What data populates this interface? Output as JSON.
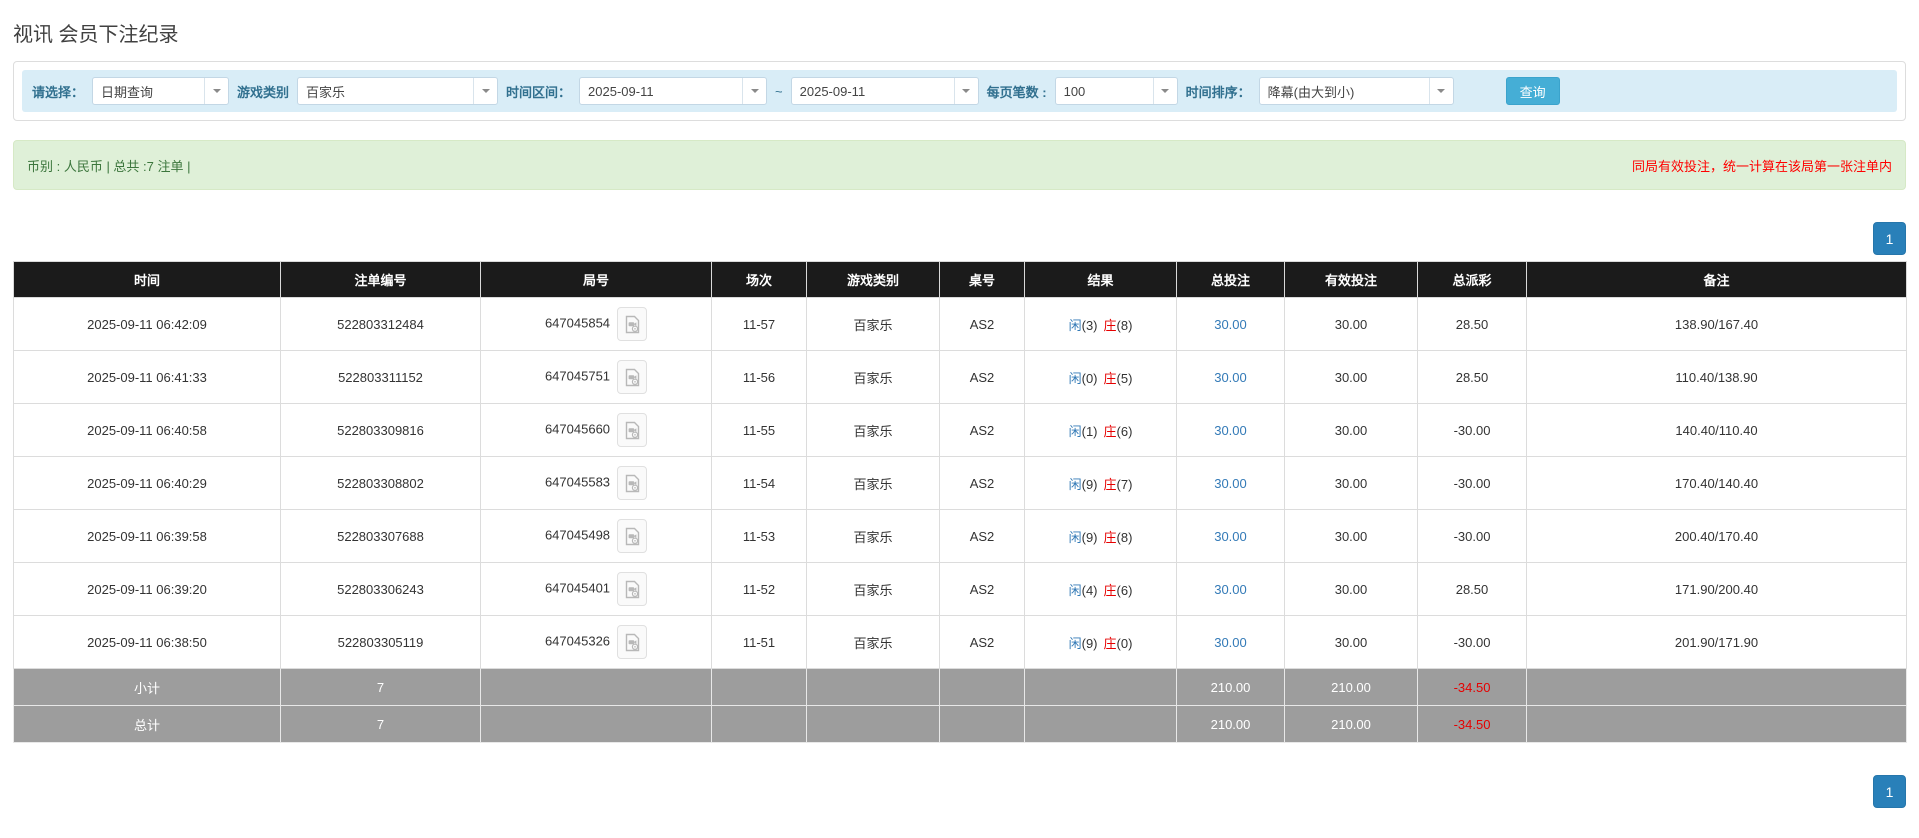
{
  "page": {
    "title": "视讯 会员下注纪录"
  },
  "filters": {
    "select_label": "请选择：",
    "select_value": "日期查询",
    "game_label": "游戏类别",
    "game_value": "百家乐",
    "range_label": "时间区间：",
    "date_from": "2025-09-11",
    "range_sep": "~",
    "date_to": "2025-09-11",
    "page_size_label": "每页笔数 :",
    "page_size_value": "100",
    "sort_label": "时间排序：",
    "sort_value": "降幕(由大到小)",
    "search_button": "查询"
  },
  "summary": {
    "left_text": "币别 : 人民币 | 总共 :7 注单 |",
    "right_note": "同局有效投注，统一计算在该局第一张注单内"
  },
  "pagination": {
    "page": "1"
  },
  "table": {
    "headers": [
      "时间",
      "注单编号",
      "局号",
      "场次",
      "游戏类别",
      "桌号",
      "结果",
      "总投注",
      "有效投注",
      "总派彩",
      "备注"
    ],
    "result_labels": {
      "player": "闲",
      "banker": "庄"
    },
    "rows": [
      {
        "time": "2025-09-11 06:42:09",
        "bet_id": "522803312484",
        "round_id": "647045854",
        "session": "11-57",
        "game": "百家乐",
        "table_no": "AS2",
        "player_pts": "(3)",
        "banker_pts": "(8)",
        "total_bet": "30.00",
        "valid_bet": "30.00",
        "payout": "28.50",
        "remark": "138.90/167.40"
      },
      {
        "time": "2025-09-11 06:41:33",
        "bet_id": "522803311152",
        "round_id": "647045751",
        "session": "11-56",
        "game": "百家乐",
        "table_no": "AS2",
        "player_pts": "(0)",
        "banker_pts": "(5)",
        "total_bet": "30.00",
        "valid_bet": "30.00",
        "payout": "28.50",
        "remark": "110.40/138.90"
      },
      {
        "time": "2025-09-11 06:40:58",
        "bet_id": "522803309816",
        "round_id": "647045660",
        "session": "11-55",
        "game": "百家乐",
        "table_no": "AS2",
        "player_pts": "(1)",
        "banker_pts": "(6)",
        "total_bet": "30.00",
        "valid_bet": "30.00",
        "payout": "-30.00",
        "remark": "140.40/110.40"
      },
      {
        "time": "2025-09-11 06:40:29",
        "bet_id": "522803308802",
        "round_id": "647045583",
        "session": "11-54",
        "game": "百家乐",
        "table_no": "AS2",
        "player_pts": "(9)",
        "banker_pts": "(7)",
        "total_bet": "30.00",
        "valid_bet": "30.00",
        "payout": "-30.00",
        "remark": "170.40/140.40"
      },
      {
        "time": "2025-09-11 06:39:58",
        "bet_id": "522803307688",
        "round_id": "647045498",
        "session": "11-53",
        "game": "百家乐",
        "table_no": "AS2",
        "player_pts": "(9)",
        "banker_pts": "(8)",
        "total_bet": "30.00",
        "valid_bet": "30.00",
        "payout": "-30.00",
        "remark": "200.40/170.40"
      },
      {
        "time": "2025-09-11 06:39:20",
        "bet_id": "522803306243",
        "round_id": "647045401",
        "session": "11-52",
        "game": "百家乐",
        "table_no": "AS2",
        "player_pts": "(4)",
        "banker_pts": "(6)",
        "total_bet": "30.00",
        "valid_bet": "30.00",
        "payout": "28.50",
        "remark": "171.90/200.40"
      },
      {
        "time": "2025-09-11 06:38:50",
        "bet_id": "522803305119",
        "round_id": "647045326",
        "session": "11-51",
        "game": "百家乐",
        "table_no": "AS2",
        "player_pts": "(9)",
        "banker_pts": "(0)",
        "total_bet": "30.00",
        "valid_bet": "30.00",
        "payout": "-30.00",
        "remark": "201.90/171.90"
      }
    ],
    "subtotal": {
      "label": "小计",
      "count": "7",
      "total_bet": "210.00",
      "valid_bet": "210.00",
      "payout": "-34.50",
      "remark": ""
    },
    "total": {
      "label": "总计",
      "count": "7",
      "total_bet": "210.00",
      "valid_bet": "210.00",
      "payout": "-34.50",
      "remark": ""
    }
  },
  "colors": {
    "header_bg": "#1b1b1b",
    "filter_bar_bg": "#d9edf7",
    "summary_bg": "#dff0d8",
    "pager_blue": "#2980b9",
    "search_button_blue": "#45aed6",
    "link_blue": "#337ab7",
    "player_blue": "#337ab7",
    "banker_red": "#e60000",
    "negative_red": "#e60000",
    "note_red": "#ff0000",
    "subtotal_gray": "#9d9d9d"
  }
}
